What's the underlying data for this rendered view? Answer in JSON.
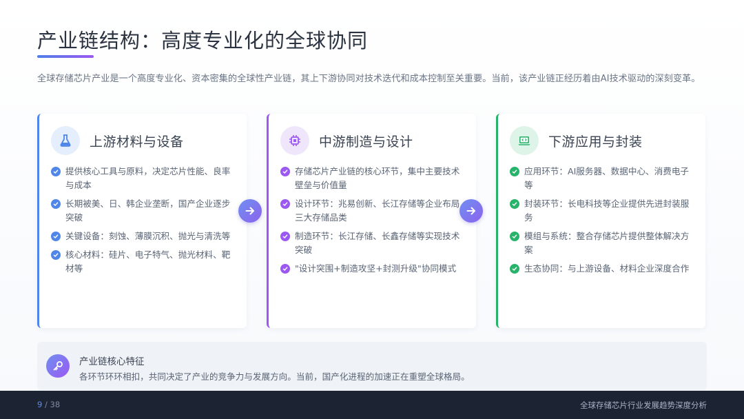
{
  "header": {
    "title": "产业链结构：高度专业化的全球协同",
    "intro": "全球存储芯片产业是一个高度专业化、资本密集的全球性产业链，其上下游协同对技术迭代和成本控制至关重要。当前，该产业链正经历着由AI技术驱动的深刻变革。"
  },
  "cards": [
    {
      "title": "上游材料与设备",
      "icon": "flask-icon",
      "accent": "#4f86e8",
      "items": [
        "提供核心工具与原料，决定芯片性能、良率与成本",
        "长期被美、日、韩企业垄断，国产企业逐步突破",
        "关键设备：刻蚀、薄膜沉积、抛光与清洗等",
        "核心材料：硅片、电子特气、抛光材料、靶材等"
      ]
    },
    {
      "title": "中游制造与设计",
      "icon": "chip-icon",
      "accent": "#9b59f2",
      "items": [
        "存储芯片产业链的核心环节，集中主要技术壁垒与价值量",
        "设计环节：兆易创新、长江存储等企业布局三大存储品类",
        "制造环节：长江存储、长鑫存储等实现技术突破",
        "\"设计突围+制造攻坚+封测升级\"协同模式"
      ]
    },
    {
      "title": "下游应用与封装",
      "icon": "laptop-code-icon",
      "accent": "#27b36a",
      "items": [
        "应用环节：AI服务器、数据中心、消费电子等",
        "封装环节：长电科技等企业提供先进封装服务",
        "模组与系统：整合存储芯片提供整体解决方案",
        "生态协同：与上游设备、材料企业深度合作"
      ]
    }
  ],
  "feature": {
    "icon": "key-icon",
    "title": "产业链核心特征",
    "desc": "各环节环环相扣，共同决定了产业的竞争力与发展方向。当前，国产化进程的加速正在重塑全球格局。"
  },
  "footer": {
    "page_current": "9",
    "page_total": "/ 38",
    "doc_title": "全球存储芯片行业发展趋势深度分析"
  }
}
